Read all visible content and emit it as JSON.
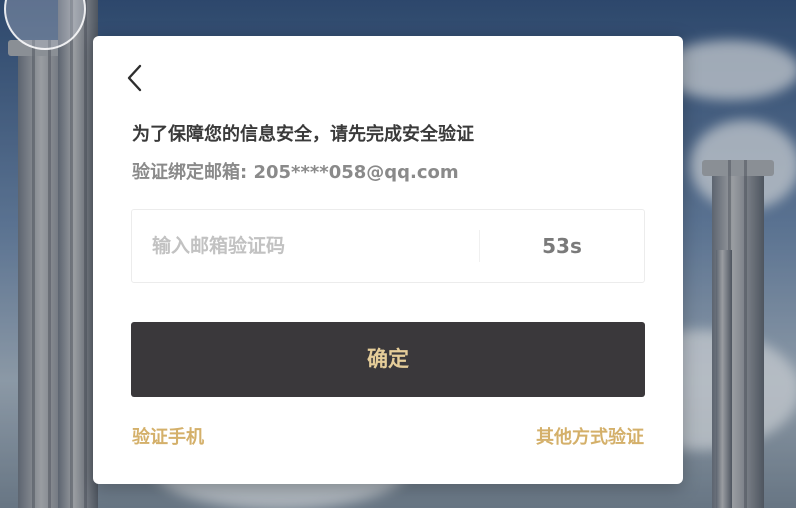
{
  "dialog": {
    "back_icon": "chevron-left-icon",
    "notice": "为了保障您的信息安全，请先完成安全验证",
    "email_line": "验证绑定邮箱: 205****058@qq.com",
    "code_input": {
      "placeholder": "输入邮箱验证码",
      "value": ""
    },
    "countdown": "53s",
    "confirm_label": "确定",
    "verify_phone_label": "验证手机",
    "other_method_label": "其他方式验证"
  },
  "colors": {
    "dialog_bg": "#ffffff",
    "confirm_bg": "#3a383b",
    "confirm_text": "#e5cd99",
    "link_gold": "#d4b06a",
    "notice_text": "#3a3a3a",
    "muted_text": "#8a8a8a"
  }
}
